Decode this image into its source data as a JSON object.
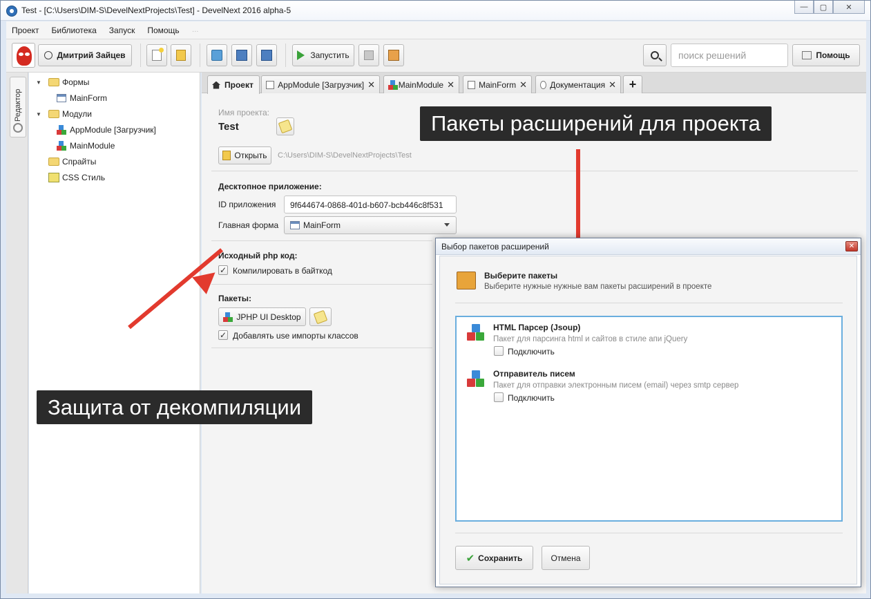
{
  "window": {
    "title": "Test - [C:\\Users\\DIM-S\\DevelNextProjects\\Test] - DevelNext 2016 alpha-5",
    "minimize_label": "—",
    "maximize_label": "▢",
    "close_label": "✕"
  },
  "menu": {
    "items": [
      "Проект",
      "Библиотека",
      "Запуск",
      "Помощь"
    ]
  },
  "toolbar": {
    "user_label": "Дмитрий Зайцев",
    "run_label": "Запустить",
    "search_placeholder": "поиск решений",
    "help_label": "Помощь"
  },
  "sidebar": {
    "tab_label": "Редактор",
    "tree": {
      "forms_label": "Формы",
      "mainform_label": "MainForm",
      "modules_label": "Модули",
      "appmodule_label": "AppModule [Загрузчик]",
      "mainmodule_label": "MainModule",
      "sprites_label": "Спрайты",
      "css_label": "CSS Стиль"
    }
  },
  "tabs": [
    {
      "label": "Проект"
    },
    {
      "label": "AppModule [Загрузчик]"
    },
    {
      "label": "MainModule"
    },
    {
      "label": "MainForm"
    },
    {
      "label": "Документация"
    },
    {
      "label": "+"
    }
  ],
  "project": {
    "name_caption": "Имя проекта:",
    "name_value": "Test",
    "open_label": "Открыть",
    "path": "C:\\Users\\DIM-S\\DevelNextProjects\\Test",
    "desktop_heading": "Десктопное приложение:",
    "app_id_label": "ID приложения",
    "app_id_value": "9f644674-0868-401d-b607-bcb446c8f531",
    "main_form_label": "Главная форма",
    "main_form_value": "MainForm",
    "php_heading": "Исходный php код:",
    "compile_label": "Компилировать в байткод",
    "packages_heading": "Пакеты:",
    "package_name": "JPHP UI Desktop",
    "add_imports_label": "Добавлять use импорты классов"
  },
  "callouts": {
    "top": "Пакеты расширений для проекта",
    "bottom": "Защита от декомпиляции"
  },
  "dialog": {
    "title": "Выбор пакетов расширений",
    "header_title": "Выберите пакеты",
    "header_subtitle": "Выберите нужные нужные вам пакеты расширений в проекте",
    "packages": [
      {
        "name": "HTML Парсер (Jsoup)",
        "description": "Пакет для парсинга html и сайтов в стиле апи jQuery",
        "connect_label": "Подключить"
      },
      {
        "name": "Отправитель писем",
        "description": "Пакет для отправки электронным писем (email) через smtp сервер",
        "connect_label": "Подключить"
      }
    ],
    "save_label": "Сохранить",
    "cancel_label": "Отмена"
  },
  "colors": {
    "arrow": "#e23a2e",
    "selection_border": "#6aaede",
    "callout_bg": "#2b2b2b"
  }
}
